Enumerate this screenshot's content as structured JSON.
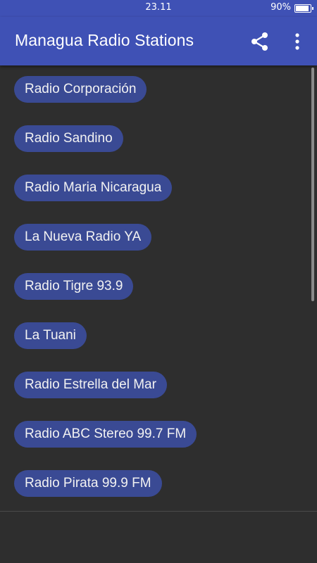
{
  "status_bar": {
    "time": "23.11",
    "battery": "90%"
  },
  "app_bar": {
    "title": "Managua Radio Stations",
    "actions": [
      "share-icon",
      "more-vert-icon"
    ]
  },
  "stations": [
    "Radio Corporación",
    "Radio Sandino",
    "Radio Maria Nicaragua",
    "La Nueva Radio YA",
    "Radio Tigre 93.9",
    "La Tuani",
    "Radio Estrella del Mar",
    "Radio ABC Stereo 99.7 FM",
    "Radio Pirata 99.9 FM"
  ],
  "colors": {
    "primary": "#3f51b5",
    "background": "#2e2e2e",
    "button": "#3a4a94",
    "button_text": "#f2f2f2"
  }
}
